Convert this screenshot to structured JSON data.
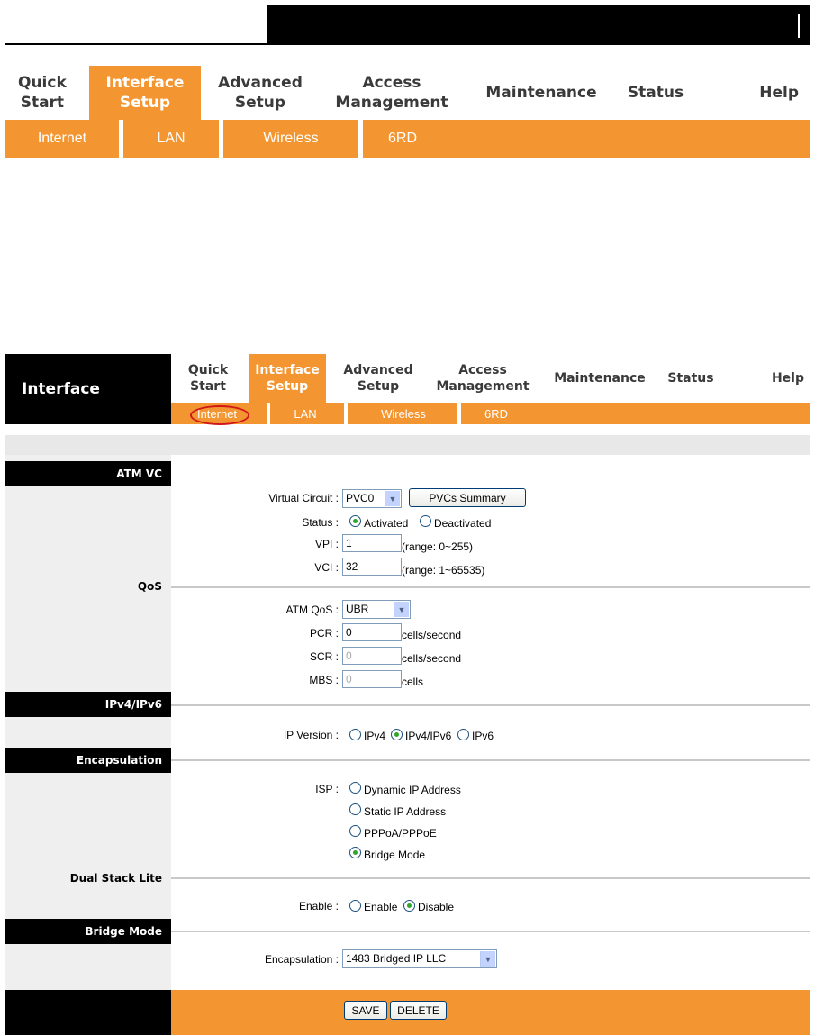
{
  "top_nav": {
    "items": [
      {
        "label": "Quick\nStart",
        "active": false
      },
      {
        "label": "Interface\nSetup",
        "active": true
      },
      {
        "label": "Advanced\nSetup",
        "active": false
      },
      {
        "label": "Access\nManagement",
        "active": false
      },
      {
        "label": "Maintenance",
        "active": false
      },
      {
        "label": "Status",
        "active": false
      },
      {
        "label": "Help",
        "active": false
      }
    ],
    "sub_items": [
      "Internet",
      "LAN",
      "Wireless",
      "6RD"
    ]
  },
  "panel": {
    "header": "Interface",
    "nav": [
      "Quick\nStart",
      "Interface\nSetup",
      "Advanced\nSetup",
      "Access\nManagement",
      "Maintenance",
      "Status",
      "Help"
    ],
    "sub": [
      "Internet",
      "LAN",
      "Wireless",
      "6RD"
    ]
  },
  "sections": {
    "atm_vc": "ATM VC",
    "qos": "QoS",
    "ipv4ipv6": "IPv4/IPv6",
    "encapsulation": "Encapsulation",
    "dual_stack": "Dual Stack Lite",
    "bridge_mode": "Bridge Mode"
  },
  "form": {
    "virtual_circuit_label": "Virtual Circuit :",
    "virtual_circuit_value": "PVC0",
    "pvcs_summary_button": "PVCs Summary",
    "status_label": "Status :",
    "status_activated": "Activated",
    "status_deactivated": "Deactivated",
    "vpi_label": "VPI :",
    "vpi_value": "1",
    "vpi_range": "(range: 0~255)",
    "vci_label": "VCI :",
    "vci_value": "32",
    "vci_range": "(range: 1~65535)",
    "atm_qos_label": "ATM QoS :",
    "atm_qos_value": "UBR",
    "pcr_label": "PCR :",
    "pcr_value": "0",
    "pcr_unit": "cells/second",
    "scr_label": "SCR :",
    "scr_value": "0",
    "scr_unit": "cells/second",
    "mbs_label": "MBS :",
    "mbs_value": "0",
    "mbs_unit": "cells",
    "ip_version_label": "IP Version :",
    "ip_ipv4": "IPv4",
    "ip_ipv4ipv6": "IPv4/IPv6",
    "ip_ipv6": "IPv6",
    "isp_label": "ISP :",
    "isp_dynamic": "Dynamic IP Address",
    "isp_static": "Static IP Address",
    "isp_pppoa": "PPPoA/PPPoE",
    "isp_bridge": "Bridge Mode",
    "enable_label": "Enable :",
    "enable_opt": "Enable",
    "disable_opt": "Disable",
    "encap_label": "Encapsulation :",
    "encap_value": "1483 Bridged IP LLC",
    "save_button": "SAVE",
    "delete_button": "DELETE"
  },
  "colors": {
    "accent": "#f39631",
    "header_bg": "#000000",
    "left_column_bg": "#efefef"
  }
}
